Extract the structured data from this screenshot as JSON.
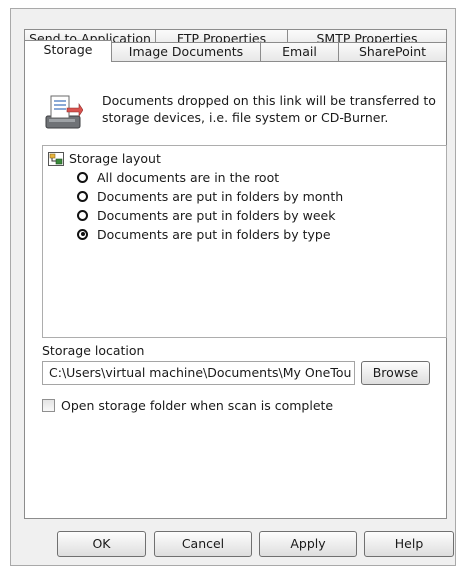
{
  "tabs_top": [
    "Send to Application",
    "FTP Properties",
    "SMTP Properties"
  ],
  "tabs_bottom": [
    "Storage",
    "Image Documents",
    "Email",
    "SharePoint"
  ],
  "info": {
    "line1": "Documents dropped on this link will be transferred to",
    "line2": "storage devices, i.e. file system or CD-Burner."
  },
  "layout": {
    "title": "Storage layout",
    "options": [
      "All documents are in the root",
      "Documents are put in folders by month",
      "Documents are put in folders by week",
      "Documents are put in folders by type"
    ],
    "selected_index": 3
  },
  "location": {
    "label": "Storage location",
    "value": "C:\\Users\\virtual machine\\Documents\\My OneTou",
    "browse": "Browse"
  },
  "open_folder": {
    "label": "Open storage folder when scan is complete",
    "checked": false
  },
  "buttons": {
    "ok": "OK",
    "cancel": "Cancel",
    "apply": "Apply",
    "help": "Help"
  }
}
